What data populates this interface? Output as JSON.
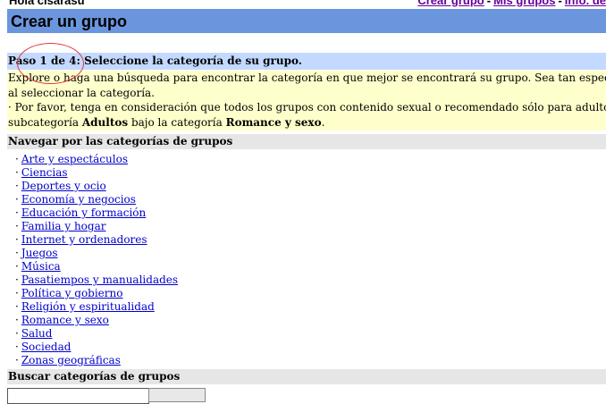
{
  "topbar": {
    "greeting": "Hola cisarasu",
    "links": [
      "Crear grupo",
      "Mis grupos",
      "Info. de"
    ],
    "separator": "-"
  },
  "title": "Crear un grupo",
  "step": "Paso 1 de 4: Seleccione la categoría de su grupo.",
  "note": {
    "line1": "Explore o haga una búsqueda para encontrar la categoría en que mejor se encontrará su grupo. Sea tan específico como sea po",
    "line2": "al seleccionar la categoría.",
    "line3": "· Por favor, tenga en consideración que todos los grupos con contenido sexual o recomendado sólo para adultos deben incluir",
    "line4_pre": "subcategoría ",
    "line4_adult": "Adultos",
    "line4_mid": " bajo la categoría ",
    "line4_cat": "Romance y sexo",
    "line4_end": "."
  },
  "browse_heading": "Navegar por las categorías de grupos",
  "bullet": "·",
  "categories": [
    "Arte y espectáculos",
    "Ciencias",
    "Deportes y ocio",
    "Economía y negocios",
    "Educación y formación",
    "Familia y hogar",
    "Internet y ordenadores",
    "Juegos",
    "Música",
    "Pasatiempos y manualidades",
    "Política y gobierno",
    "Religión y espiritualidad",
    "Romance y sexo",
    "Salud",
    "Sociedad",
    "Zonas geográficas"
  ],
  "search_heading": "Buscar categorías de grupos",
  "search": {
    "value": "",
    "button_label": ""
  }
}
